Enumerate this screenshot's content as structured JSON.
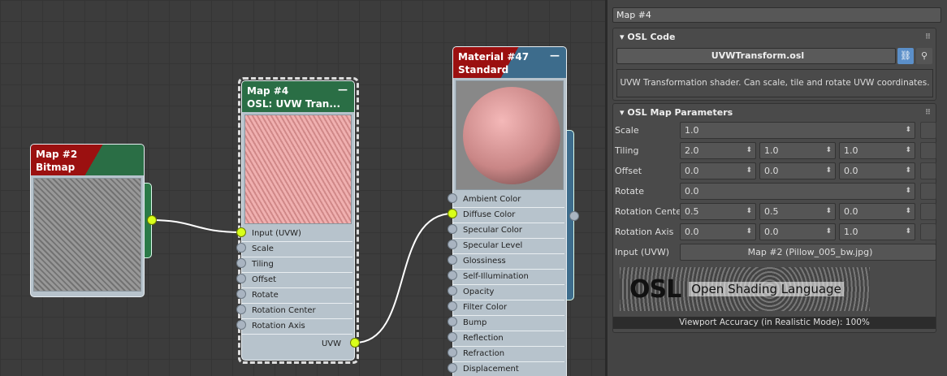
{
  "nodes": {
    "map2": {
      "title": "Map #2",
      "subtitle": "Bitmap"
    },
    "map4": {
      "title": "Map #4",
      "subtitle": "OSL: UVW Tran...",
      "inputs": [
        "Input (UVW)",
        "Scale",
        "Tiling",
        "Offset",
        "Rotate",
        "Rotation Center",
        "Rotation Axis"
      ],
      "output": "UVW"
    },
    "material": {
      "title": "Material #47",
      "subtitle": "Standard",
      "inputs": [
        "Ambient Color",
        "Diffuse Color",
        "Specular Color",
        "Specular Level",
        "Glossiness",
        "Self-Illumination",
        "Opacity",
        "Filter Color",
        "Bump",
        "Reflection",
        "Refraction",
        "Displacement"
      ]
    }
  },
  "panel": {
    "name": "Map #4",
    "osl_code": {
      "title": "OSL Code",
      "file": "UVWTransform.osl",
      "description": "UVW Transformation shader. Can scale, tile and rotate UVW coordinates.",
      "link_icon": "link-icon",
      "browse_icon": "magnifier-icon"
    },
    "params": {
      "title": "OSL Map Parameters",
      "scale": {
        "label": "Scale",
        "value": "1.0"
      },
      "tiling": {
        "label": "Tiling",
        "values": [
          "2.0",
          "1.0",
          "1.0"
        ]
      },
      "offset": {
        "label": "Offset",
        "values": [
          "0.0",
          "0.0",
          "0.0"
        ]
      },
      "rotate": {
        "label": "Rotate",
        "value": "0.0"
      },
      "rotation_center": {
        "label": "Rotation Center",
        "values": [
          "0.5",
          "0.5",
          "0.0"
        ]
      },
      "rotation_axis": {
        "label": "Rotation Axis",
        "values": [
          "0.0",
          "0.0",
          "1.0"
        ]
      },
      "input": {
        "label": "Input (UVW)",
        "value": "Map #2 (Pillow_005_bw.jpg)"
      }
    },
    "logo": {
      "mark": "OSL",
      "text": "Open Shading Language"
    },
    "viewport_accuracy": "Viewport Accuracy (in Realistic Mode): 100%"
  },
  "colors": {
    "map_header": "#2a6e45",
    "material_header": "#9b1010",
    "material_header2": "#3d6c8c",
    "socket_active": "#d9ff1a",
    "accent": "#5a8fc8"
  }
}
